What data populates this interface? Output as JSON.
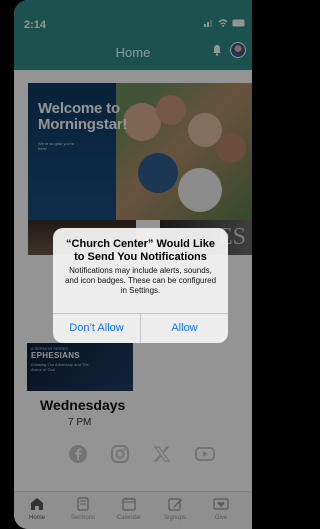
{
  "status_bar": {
    "time": "2:14"
  },
  "header": {
    "title": "Home"
  },
  "banner": {
    "headline_line1": "Welcome to",
    "headline_line2": "Morningstar!",
    "tagline": "We're so glad you're here!"
  },
  "cards": {
    "right_letters": "ES"
  },
  "event": {
    "image_small": "A SERMON SERIES",
    "image_title": "EPHESIANS",
    "image_sub": "Knowing Our Adversary and The Armor of God",
    "day": "Wednesdays",
    "time": "7 PM"
  },
  "alert": {
    "title": "“Church Center” Would Like to Send You Notifications",
    "message": "Notifications may include alerts, sounds, and icon badges. These can be configured in Settings.",
    "deny_label": "Don’t Allow",
    "allow_label": "Allow"
  },
  "tabs": [
    {
      "label": "Home",
      "icon": "home-icon"
    },
    {
      "label": "Sermons",
      "icon": "book-icon"
    },
    {
      "label": "Calendar",
      "icon": "calendar-icon"
    },
    {
      "label": "Signups",
      "icon": "edit-icon"
    },
    {
      "label": "Give",
      "icon": "donate-icon"
    }
  ],
  "colors": {
    "header": "#2f8c88",
    "alert_button": "#0a7aff"
  }
}
